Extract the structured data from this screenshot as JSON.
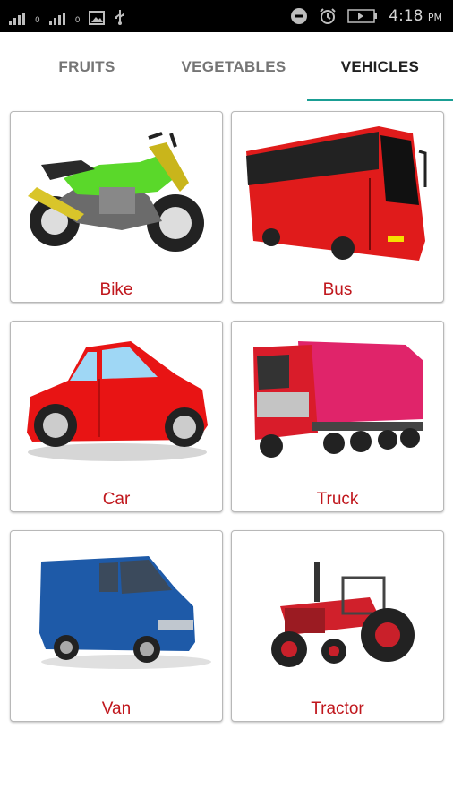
{
  "status_bar": {
    "time": "4:18",
    "ampm": "PM",
    "network_labels": [
      "0",
      "0"
    ]
  },
  "tabs": [
    {
      "label": "FRUITS",
      "active": false
    },
    {
      "label": "VEGETABLES",
      "active": false
    },
    {
      "label": "VEHICLES",
      "active": true
    }
  ],
  "accent_color": "#1a9e94",
  "label_color": "#c0171d",
  "items": [
    {
      "label": "Bike",
      "icon": "motorbike-image"
    },
    {
      "label": "Bus",
      "icon": "bus-image"
    },
    {
      "label": "Car",
      "icon": "car-image"
    },
    {
      "label": "Truck",
      "icon": "truck-image"
    },
    {
      "label": "Van",
      "icon": "van-image"
    },
    {
      "label": "Tractor",
      "icon": "tractor-image"
    }
  ]
}
